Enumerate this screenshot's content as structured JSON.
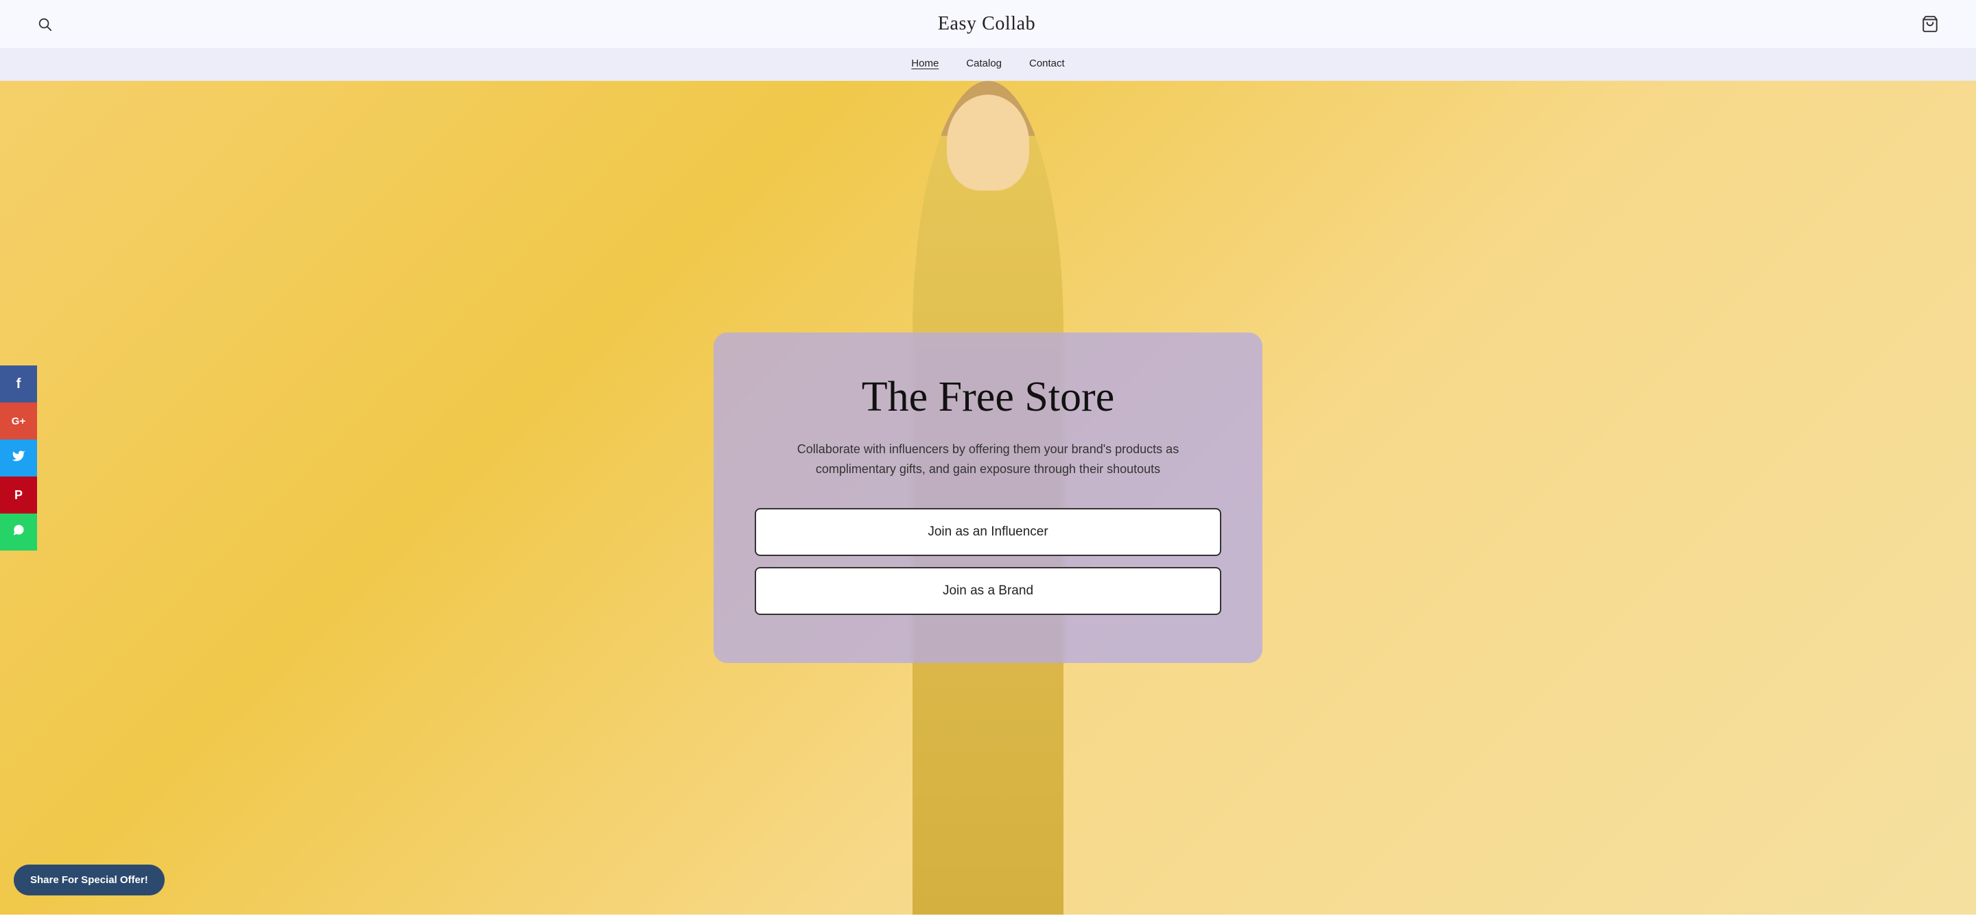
{
  "header": {
    "site_title": "Easy Collab",
    "search_aria": "Search",
    "cart_aria": "Cart"
  },
  "nav": {
    "items": [
      {
        "label": "Home",
        "active": true
      },
      {
        "label": "Catalog",
        "active": false
      },
      {
        "label": "Contact",
        "active": false
      }
    ]
  },
  "hero": {
    "card": {
      "title": "The Free Store",
      "description": "Collaborate with influencers by offering them your brand's products as complimentary gifts, and gain exposure through their shoutouts",
      "button_influencer": "Join as an Influencer",
      "button_brand": "Join as a Brand"
    }
  },
  "social": {
    "items": [
      {
        "name": "facebook",
        "icon": "f",
        "label": "Facebook"
      },
      {
        "name": "googleplus",
        "icon": "G+",
        "label": "Google Plus"
      },
      {
        "name": "twitter",
        "icon": "t",
        "label": "Twitter"
      },
      {
        "name": "pinterest",
        "icon": "P",
        "label": "Pinterest"
      },
      {
        "name": "whatsapp",
        "icon": "W",
        "label": "WhatsApp"
      }
    ],
    "share_button_label": "Share For Special Offer!"
  }
}
